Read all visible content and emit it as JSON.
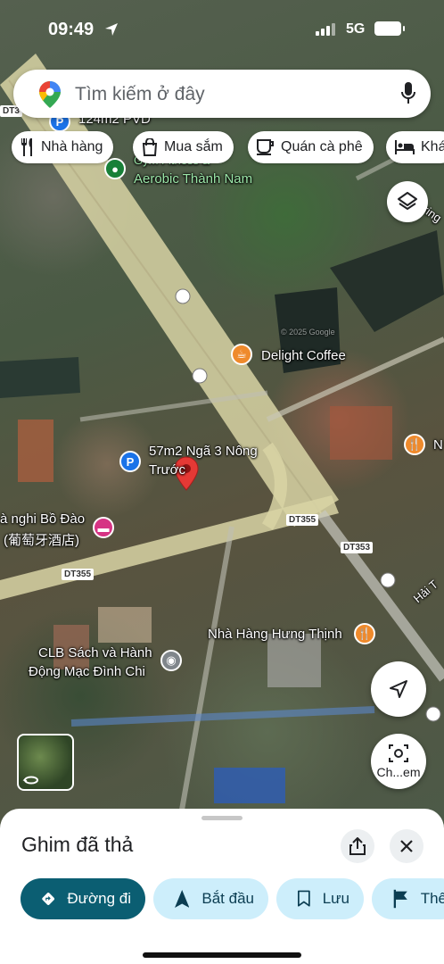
{
  "status_bar": {
    "time": "09:49",
    "network": "5G"
  },
  "search": {
    "placeholder": "Tìm kiếm ở đây"
  },
  "chips": [
    {
      "label": "Nhà hàng",
      "icon": "restaurant-icon"
    },
    {
      "label": "Mua sắm",
      "icon": "shopping-bag-icon"
    },
    {
      "label": "Quán cà phê",
      "icon": "coffee-icon"
    },
    {
      "label": "Khá",
      "icon": "hotel-icon"
    }
  ],
  "map": {
    "places": {
      "pvd": "124m2 PVD",
      "gym": "Gym Fitness &",
      "aerobic": "Aerobic Thành Nam",
      "delight": "Delight Coffee",
      "nga3": "57m2 Ngã 3 Nông",
      "truoc": "Trước",
      "nghi": "à nghi Bồ Đào",
      "chinese": "(葡萄牙酒店)",
      "clb1": "CLB Sách và Hành",
      "clb2": "Động Mạc Đình Chi",
      "hung_thinh": "Nhà Hàng Hưng Thịnh",
      "hai": "Hải T",
      "n_right": "N",
      "ring": "ring",
      "copyright": "© 2025 Google"
    },
    "road_tags": {
      "dt3": "DT3",
      "dt355_a": "DT355",
      "dt355_b": "DT355",
      "dt353": "DT353"
    }
  },
  "buttons": {
    "street_view": "Ch...em"
  },
  "sheet": {
    "title": "Ghim đã thả",
    "actions": [
      {
        "label": "Đường đi",
        "icon": "directions-icon"
      },
      {
        "label": "Bắt đầu",
        "icon": "navigation-icon"
      },
      {
        "label": "Lưu",
        "icon": "bookmark-icon"
      },
      {
        "label": "Thê",
        "icon": "flag-icon"
      }
    ]
  },
  "colors": {
    "primary": "#0b5e72",
    "secondary": "#cdeefb",
    "pin": "#e53935",
    "poi_orange": "#ef8a2c",
    "poi_blue": "#1a73e8"
  }
}
